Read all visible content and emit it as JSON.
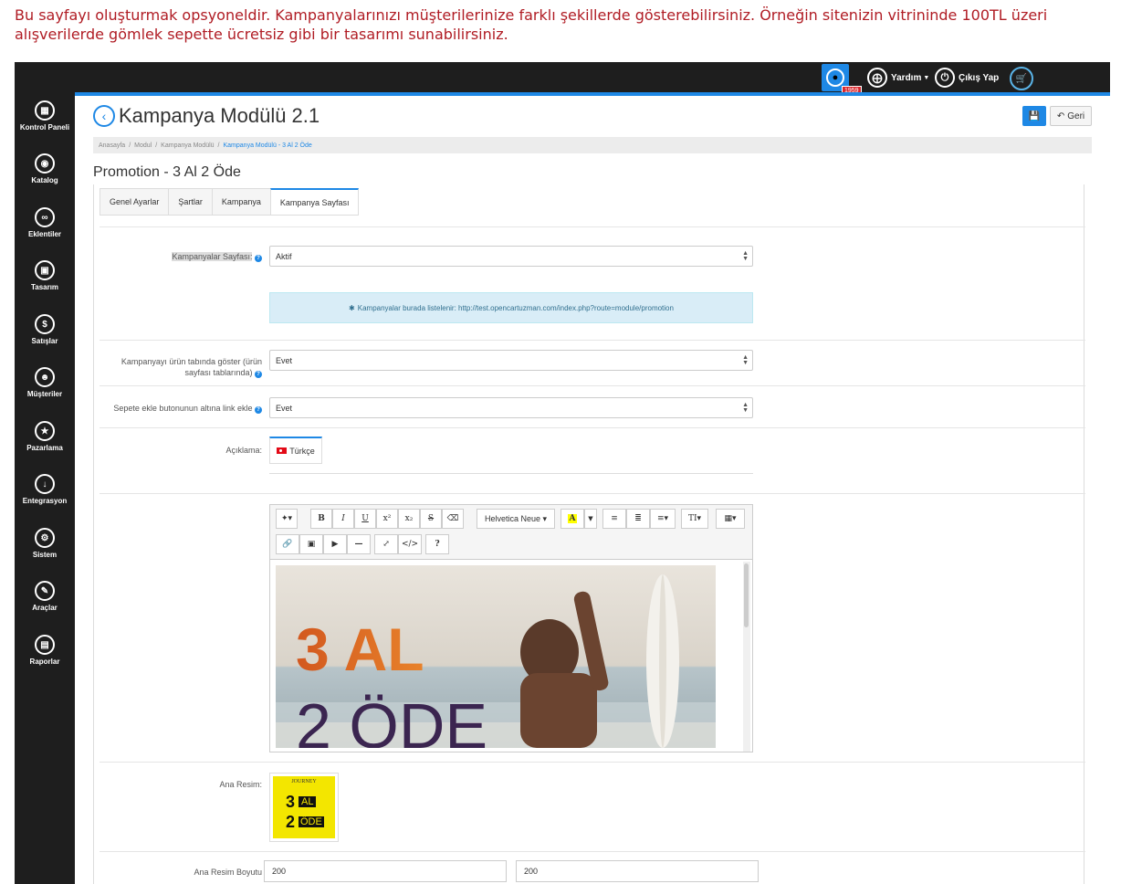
{
  "intro_text": "Bu sayfayı oluşturmak opsyoneldir. Kampanyalarınızı müşterilerinize farklı şekillerde gösterebilirsiniz. Örneğin sitenizin vitrininde 100TL üzeri alışverilerde gömlek sepette ücretsiz gibi bir tasarımı sunabilirsiniz.",
  "topbar": {
    "notification_count": "1959",
    "help_label": "Yardım",
    "logout_label": "Çıkış Yap"
  },
  "sidebar": {
    "items": [
      {
        "label": "Kontrol Paneli",
        "icon": "dashboard-icon"
      },
      {
        "label": "Katalog",
        "icon": "catalog-icon"
      },
      {
        "label": "Eklentiler",
        "icon": "extensions-icon"
      },
      {
        "label": "Tasarım",
        "icon": "design-icon"
      },
      {
        "label": "Satışlar",
        "icon": "sales-icon"
      },
      {
        "label": "Müşteriler",
        "icon": "customers-icon"
      },
      {
        "label": "Pazarlama",
        "icon": "marketing-icon"
      },
      {
        "label": "Entegrasyon",
        "icon": "integration-icon"
      },
      {
        "label": "Sistem",
        "icon": "system-icon"
      },
      {
        "label": "Araçlar",
        "icon": "tools-icon"
      },
      {
        "label": "Raporlar",
        "icon": "reports-icon"
      }
    ]
  },
  "header": {
    "title": "Kampanya Modülü 2.1",
    "back_label": "Geri"
  },
  "breadcrumb": [
    "Anasayfa",
    "Modul",
    "Kampanya Modülü",
    "Kampanya Modülü - 3 Al 2 Öde"
  ],
  "panel_title": "Promotion - 3 Al 2 Öde",
  "tabs": [
    "Genel Ayarlar",
    "Şartlar",
    "Kampanya",
    "Kampanya Sayfası"
  ],
  "form": {
    "campaign_page_label": "Kampanyalar Sayfası:",
    "campaign_page_value": "Aktif",
    "info_text": "Kampanyalar burada listelenir: http://test.opencartuzman.com/index.php?route=module/promotion",
    "show_in_tab_label_1": "Kampanyayı ürün tabında göster (ürün",
    "show_in_tab_label_2": "sayfası tablarında)",
    "show_in_tab_value": "Evet",
    "add_link_label": "Sepete ekle butonunun altına link ekle",
    "add_link_value": "Evet",
    "description_label": "Açıklama:",
    "language_tab": "Türkçe",
    "main_image_label": "Ana Resim:",
    "main_image_size_label": "Ana Resim Boyutu",
    "width_value": "200",
    "height_value": "200"
  },
  "editor": {
    "font_name": "Helvetica Neue",
    "image_text_top": "3 AL",
    "image_text_bottom": "2 ÖDE"
  },
  "thumbnail": {
    "brand": "JOURNEY",
    "line1_num": "3",
    "line1_word": "AL",
    "line2_num": "2",
    "line2_word": "ÖDE"
  }
}
